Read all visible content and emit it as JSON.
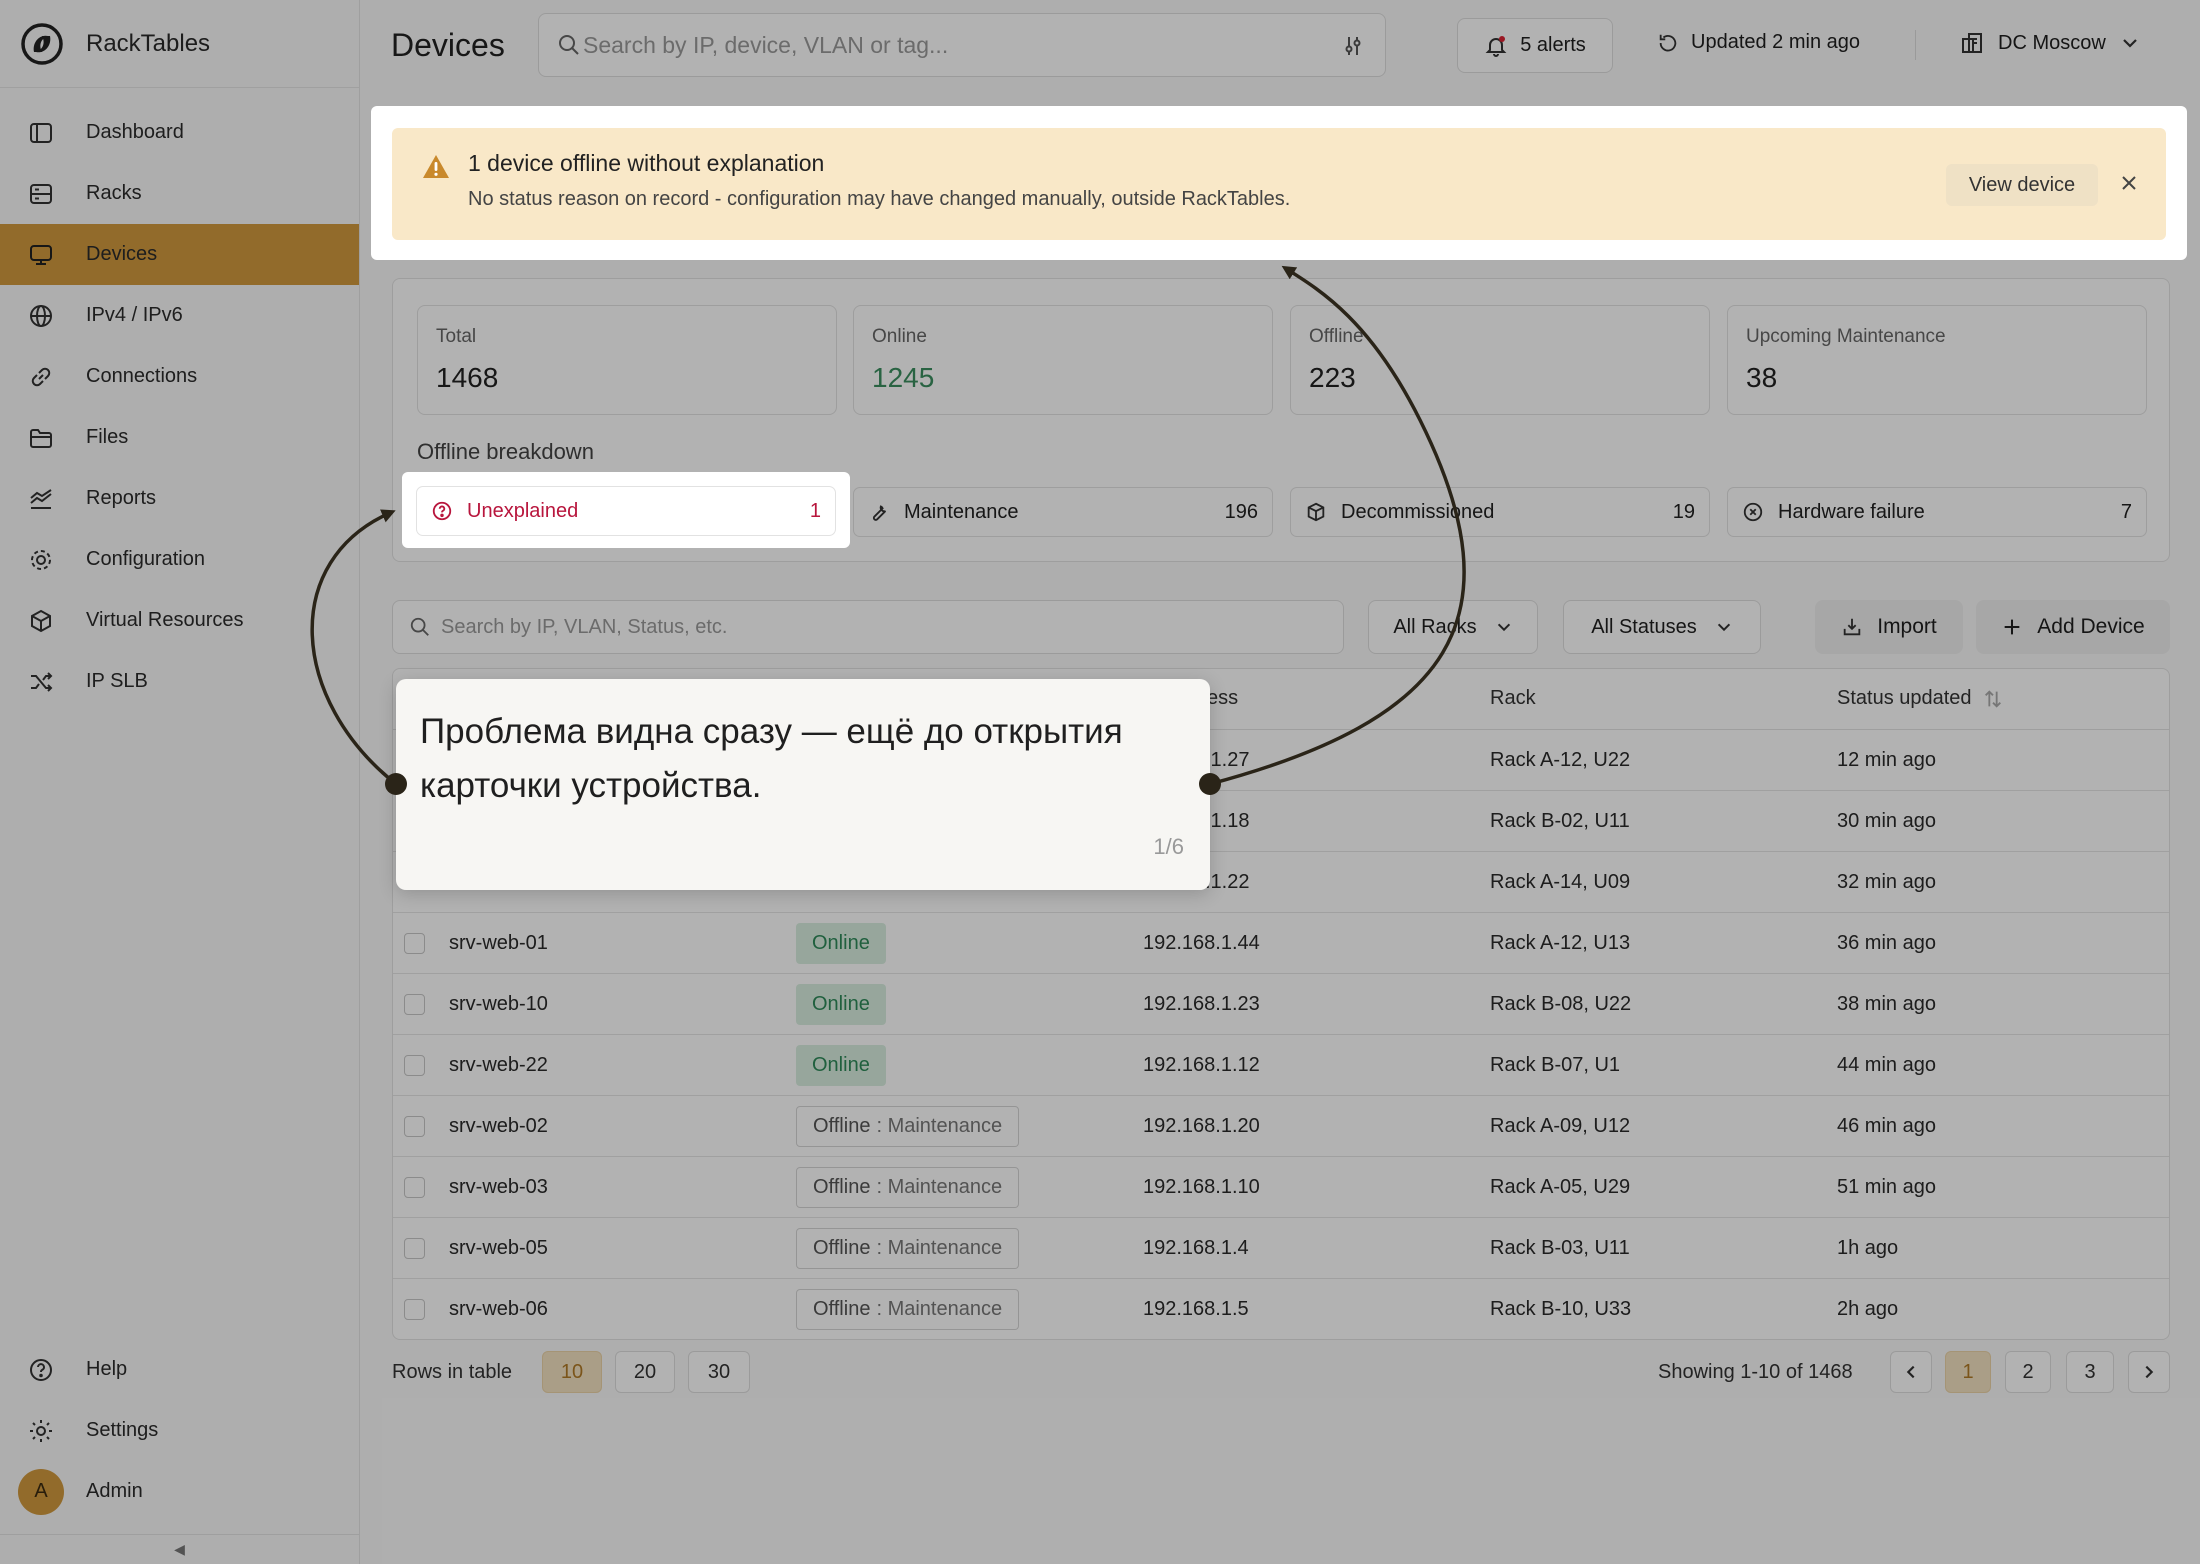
{
  "app": {
    "name": "RackTables"
  },
  "sidebar": {
    "items": [
      {
        "label": "Dashboard",
        "icon": "dashboard-icon"
      },
      {
        "label": "Racks",
        "icon": "rack-icon"
      },
      {
        "label": "Devices",
        "icon": "monitor-icon",
        "active": true
      },
      {
        "label": "IPv4 / IPv6",
        "icon": "globe-icon"
      },
      {
        "label": "Connections",
        "icon": "link-icon"
      },
      {
        "label": "Files",
        "icon": "folder-icon"
      },
      {
        "label": "Reports",
        "icon": "chart-icon"
      },
      {
        "label": "Configuration",
        "icon": "cog-icon"
      },
      {
        "label": "Virtual Resources",
        "icon": "cube-icon"
      },
      {
        "label": "IP SLB",
        "icon": "shuffle-icon"
      }
    ],
    "bottom": {
      "help": "Help",
      "settings": "Settings",
      "admin": "Admin",
      "avatar_letter": "A"
    },
    "collapse_glyph": "◀"
  },
  "header": {
    "title": "Devices",
    "search_placeholder": "Search by IP, device, VLAN or tag...",
    "alerts": "5 alerts",
    "updated": "Updated 2 min ago",
    "datacenter": "DC Moscow"
  },
  "banner": {
    "title": "1 device offline without explanation",
    "subtitle": "No status reason on record - configuration may have changed manually, outside RackTables.",
    "action": "View device"
  },
  "stats": [
    {
      "label": "Total",
      "value": "1468"
    },
    {
      "label": "Online",
      "value": "1245"
    },
    {
      "label": "Offline",
      "value": "223"
    },
    {
      "label": "Upcoming Maintenance",
      "value": "38"
    }
  ],
  "breakdown": {
    "title": "Offline breakdown",
    "chips": [
      {
        "label": "Unexplained",
        "count": "1",
        "icon": "question-circle-icon"
      },
      {
        "label": "Maintenance",
        "count": "196",
        "icon": "wrench-icon"
      },
      {
        "label": "Decommissioned",
        "count": "19",
        "icon": "box-icon"
      },
      {
        "label": "Hardware failure",
        "count": "7",
        "icon": "x-circle-icon"
      }
    ]
  },
  "filters": {
    "search_placeholder": "Search by IP, VLAN, Status, etc.",
    "racks": "All Racks",
    "statuses": "All Statuses",
    "import": "Import",
    "add": "Add Device"
  },
  "table": {
    "columns": {
      "address_partial": "ess",
      "rack": "Rack",
      "status_updated": "Status updated"
    },
    "partial_rows": [
      {
        "address_partial": ".1.27",
        "rack": "Rack A-12, U22",
        "updated": "12 min ago"
      },
      {
        "address_partial": ".1.18",
        "rack": "Rack B-02, U11",
        "updated": "30 min ago"
      },
      {
        "address_partial": ".1.22",
        "rack": "Rack A-14, U09",
        "updated": "32 min ago"
      }
    ],
    "rows": [
      {
        "name": "srv-web-01",
        "status": "Online",
        "ip": "192.168.1.44",
        "rack": "Rack A-12, U13",
        "updated": "36  min ago"
      },
      {
        "name": "srv-web-10",
        "status": "Online",
        "ip": "192.168.1.23",
        "rack": "Rack B-08, U22",
        "updated": "38 min ago"
      },
      {
        "name": "srv-web-22",
        "status": "Online",
        "ip": "192.168.1.12",
        "rack": "Rack B-07, U1",
        "updated": "44 min ago"
      },
      {
        "name": "srv-web-02",
        "status": "Offline",
        "reason": ": Maintenance",
        "ip": "192.168.1.20",
        "rack": "Rack A-09, U12",
        "updated": "46 min ago"
      },
      {
        "name": "srv-web-03",
        "status": "Offline",
        "reason": ": Maintenance",
        "ip": "192.168.1.10",
        "rack": "Rack A-05, U29",
        "updated": "51 min ago"
      },
      {
        "name": "srv-web-05",
        "status": "Offline",
        "reason": ": Maintenance",
        "ip": "192.168.1.4",
        "rack": "Rack B-03, U11",
        "updated": "1h ago"
      },
      {
        "name": "srv-web-06",
        "status": "Offline",
        "reason": ": Maintenance",
        "ip": "192.168.1.5",
        "rack": "Rack B-10, U33",
        "updated": "2h ago"
      }
    ]
  },
  "pagination": {
    "rows_label": "Rows in table",
    "sizes": [
      "10",
      "20",
      "30"
    ],
    "showing": "Showing 1-10 of 1468",
    "pages": [
      "1",
      "2",
      "3"
    ]
  },
  "tooltip": {
    "text": "Проблема видна сразу — ещё до открытия карточки устройства.",
    "step": "1/6"
  },
  "colors": {
    "accent": "#d19a3e",
    "online": "#2f8a5a",
    "danger": "#b8163d",
    "banner": "#f9e8c8"
  }
}
